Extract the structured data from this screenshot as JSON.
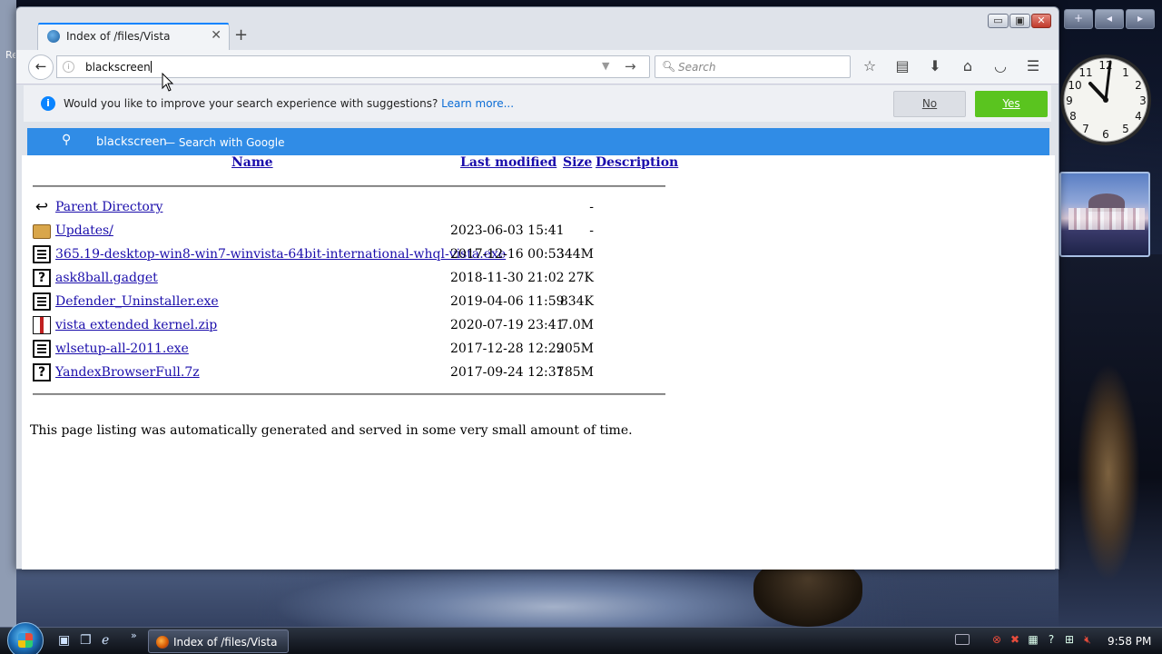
{
  "desktop": {
    "left_edge_text": "Re"
  },
  "window": {
    "tab_title": "Index of /files/Vista",
    "controls": {
      "minimize": "▭",
      "maximize": "▣",
      "close": "✕"
    }
  },
  "toolbar": {
    "url_value": "blackscreen",
    "search_placeholder": "Search"
  },
  "notification": {
    "message": "Would you like to improve your search experience with suggestions?",
    "learn_more": "Learn more...",
    "no_label": "No",
    "yes_label": "Yes"
  },
  "suggestion": {
    "query": "blackscreen",
    "action": "— Search with Google"
  },
  "listing": {
    "headers": {
      "name": "Name",
      "last_modified": "Last modified",
      "size": "Size",
      "description": "Description"
    },
    "rows": [
      {
        "icon": "back-icon",
        "name": "Parent Directory",
        "date": "",
        "size": "-"
      },
      {
        "icon": "folder-icon",
        "name": "Updates/",
        "date": "2023-06-03 15:41",
        "size": "-"
      },
      {
        "icon": "binary-file-icon",
        "name": "365.19-desktop-win8-win7-winvista-64bit-international-whql-vista.exe",
        "date": "2017-12-16 00:53",
        "size": "344M"
      },
      {
        "icon": "unknown-file-icon",
        "name": "ask8ball.gadget",
        "date": "2018-11-30 21:02",
        "size": "27K"
      },
      {
        "icon": "binary-file-icon",
        "name": "Defender_Uninstaller.exe",
        "date": "2019-04-06 11:59",
        "size": "834K"
      },
      {
        "icon": "compressed-file-icon",
        "name": "vista extended kernel.zip",
        "date": "2020-07-19 23:41",
        "size": "7.0M"
      },
      {
        "icon": "binary-file-icon",
        "name": "wlsetup-all-2011.exe",
        "date": "2017-12-28 12:29",
        "size": "205M"
      },
      {
        "icon": "unknown-file-icon",
        "name": "YandexBrowserFull.7z",
        "date": "2017-09-24 12:37",
        "size": "185M"
      }
    ],
    "footer": "This page listing was automatically generated and served in some very small amount of time."
  },
  "taskbar": {
    "task_label": "Index of /files/Vista ...",
    "time": "9:58 PM"
  },
  "gadgets": {
    "bar": [
      "+",
      "◂",
      "▸"
    ]
  }
}
